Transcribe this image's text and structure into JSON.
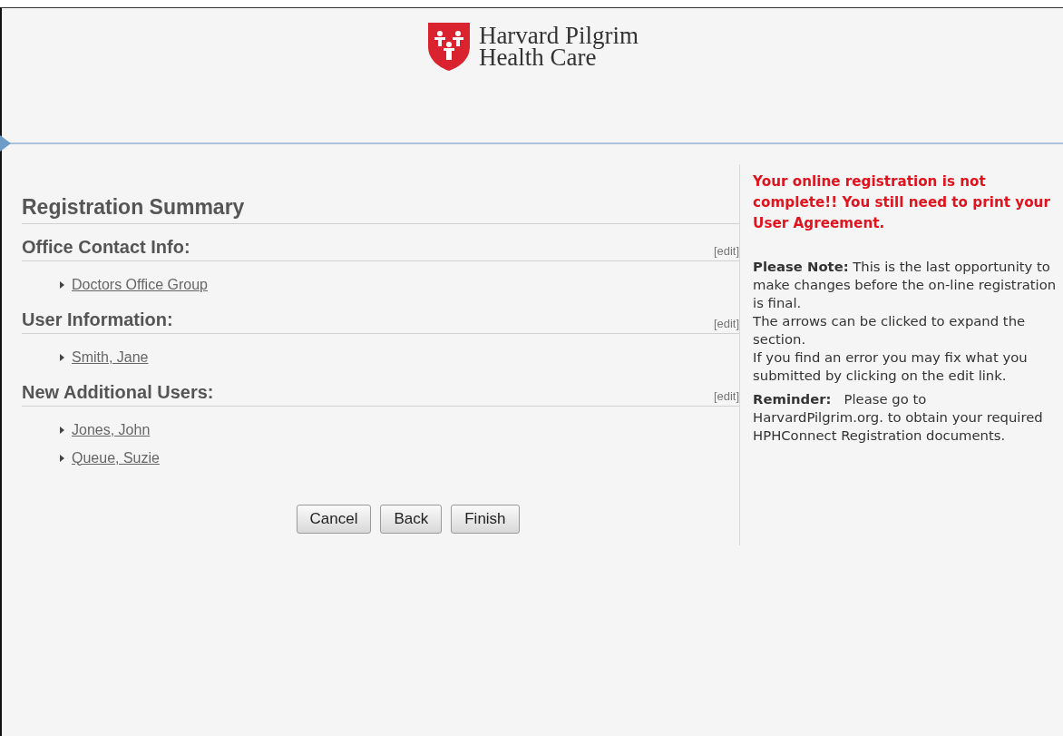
{
  "logo": {
    "lines": [
      "Harvard Pilgrim",
      "Health Care"
    ]
  },
  "summary": {
    "title": "Registration Summary",
    "sections": [
      {
        "heading": "Office Contact Info:",
        "edit": "[edit]",
        "items": [
          "Doctors Office Group"
        ]
      },
      {
        "heading": "User Information:",
        "edit": "[edit]",
        "items": [
          "Smith, Jane"
        ]
      },
      {
        "heading": "New Additional Users:",
        "edit": "[edit]",
        "items": [
          "Jones, John",
          "Queue, Suzie"
        ]
      }
    ],
    "buttons": [
      "Cancel",
      "Back",
      "Finish"
    ]
  },
  "notice": {
    "warning": "Your online registration is not complete!! You still need to print your User Agreement.",
    "note_paragraphs": [
      "**Please Note:**  This is the last opportunity to make changes before the on-line registration is final.",
      "The arrows can be clicked to expand the section.",
      "If you find an error you may fix what you submitted by clicking on the edit link."
    ],
    "reminder": {
      "label": "Reminder:",
      "before": "Please go to",
      "link": "HarvardPilgrim.org",
      "after": ". to obtain your required HPHConnect Registration documents."
    }
  }
}
